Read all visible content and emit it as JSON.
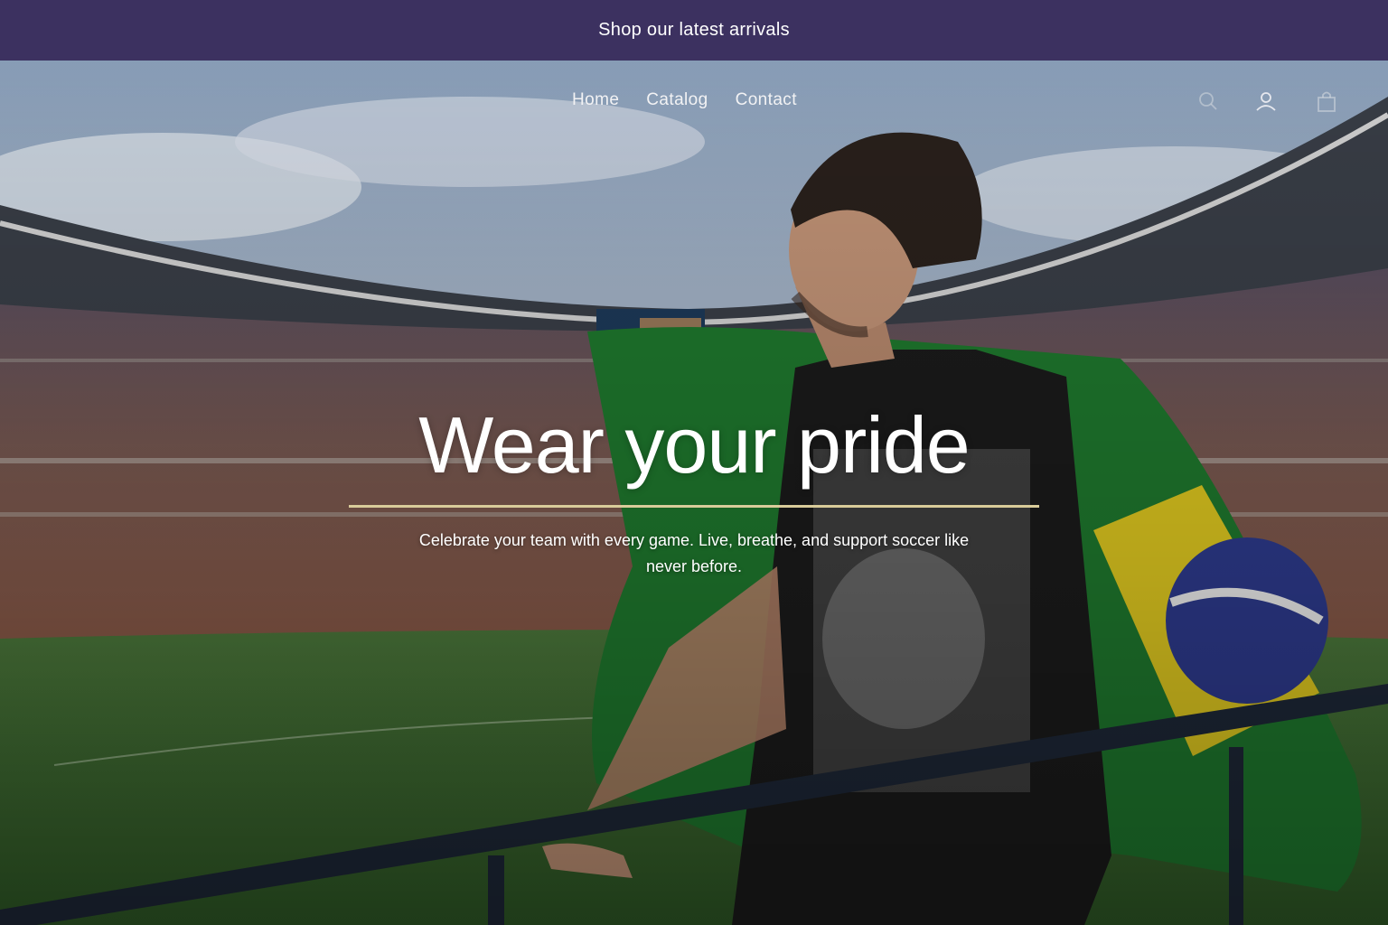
{
  "announcement": {
    "text": "Shop our latest arrivals"
  },
  "nav": {
    "links": [
      {
        "label": "Home"
      },
      {
        "label": "Catalog"
      },
      {
        "label": "Contact"
      }
    ],
    "icons": [
      "search-icon",
      "account-icon",
      "cart-icon"
    ]
  },
  "hero": {
    "title": "Wear your pride",
    "subtitle": "Celebrate your team with every game. Live, breathe, and support soccer like never before.",
    "rule_color": "#d9cc9a"
  },
  "colors": {
    "announcement_bg": "#3c3160",
    "text": "#ffffff"
  }
}
